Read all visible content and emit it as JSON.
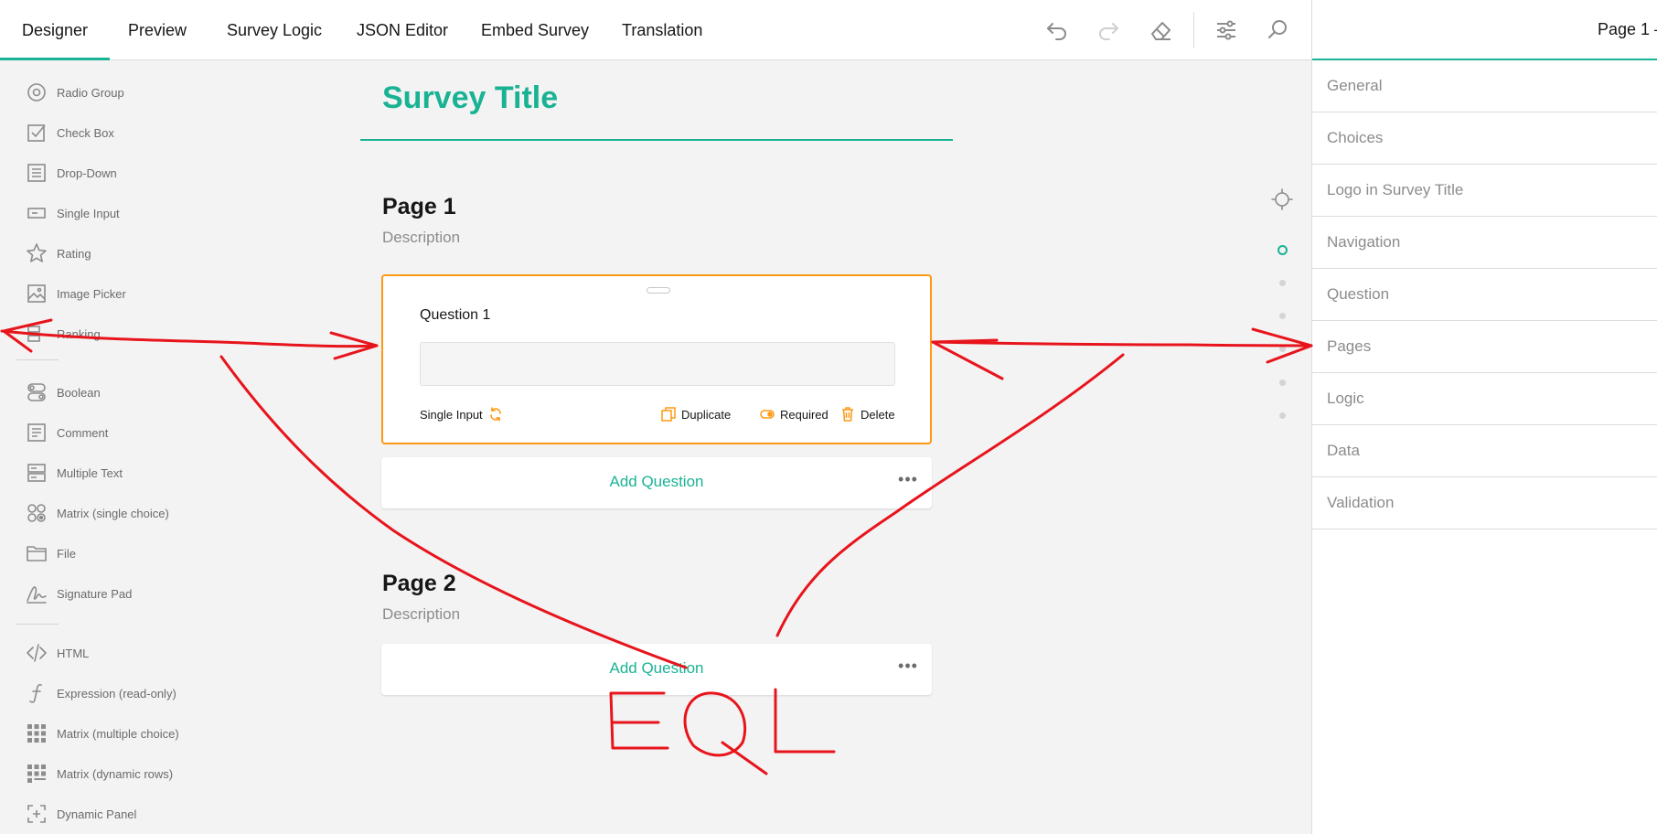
{
  "header": {
    "tabs": [
      {
        "label": "Designer"
      },
      {
        "label": "Preview"
      },
      {
        "label": "Survey Logic"
      },
      {
        "label": "JSON Editor"
      },
      {
        "label": "Embed Survey"
      },
      {
        "label": "Translation"
      }
    ],
    "tools": [
      "undo-icon",
      "redo-icon",
      "eraser-icon",
      "settings-sliders-icon",
      "search-icon"
    ]
  },
  "toolbox": {
    "groups": [
      [
        {
          "label": "Radio Group",
          "icon": "radio-group-icon"
        },
        {
          "label": "Check Box",
          "icon": "checkbox-icon"
        },
        {
          "label": "Drop-Down",
          "icon": "dropdown-icon"
        },
        {
          "label": "Single Input",
          "icon": "single-input-icon"
        },
        {
          "label": "Rating",
          "icon": "star-icon"
        },
        {
          "label": "Image Picker",
          "icon": "image-picker-icon"
        },
        {
          "label": "Ranking",
          "icon": "ranking-icon"
        }
      ],
      [
        {
          "label": "Boolean",
          "icon": "boolean-icon"
        },
        {
          "label": "Comment",
          "icon": "comment-icon"
        },
        {
          "label": "Multiple Text",
          "icon": "multiple-text-icon"
        },
        {
          "label": "Matrix (single choice)",
          "icon": "matrix-single-icon"
        },
        {
          "label": "File",
          "icon": "folder-icon"
        },
        {
          "label": "Signature Pad",
          "icon": "signature-icon"
        }
      ],
      [
        {
          "label": "HTML",
          "icon": "html-icon"
        },
        {
          "label": "Expression (read-only)",
          "icon": "expression-icon"
        },
        {
          "label": "Matrix (multiple choice)",
          "icon": "matrix-multiple-icon"
        },
        {
          "label": "Matrix (dynamic rows)",
          "icon": "matrix-dynamic-icon"
        },
        {
          "label": "Dynamic Panel",
          "icon": "dynamic-panel-icon"
        }
      ]
    ]
  },
  "canvas": {
    "survey_title": "Survey Title",
    "pages": [
      {
        "title": "Page 1",
        "description": "Description",
        "question": {
          "title": "Question 1",
          "type_label": "Single Input",
          "actions": {
            "duplicate": "Duplicate",
            "required": "Required",
            "delete": "Delete"
          }
        },
        "add_question": "Add Question"
      },
      {
        "title": "Page 2",
        "description": "Description",
        "add_question": "Add Question"
      }
    ]
  },
  "page_navigator": {
    "active_index": 0,
    "page_count": 6
  },
  "property_panel": {
    "selector_label": "Page 1 –",
    "sections": [
      "General",
      "Choices",
      "Logo in Survey Title",
      "Navigation",
      "Question",
      "Pages",
      "Logic",
      "Data",
      "Validation"
    ]
  },
  "annotation": {
    "text": "EQL",
    "color": "#e8141c"
  },
  "colors": {
    "accent": "#19b394",
    "selected_border": "#ff9814",
    "annotation": "#e8141c"
  }
}
